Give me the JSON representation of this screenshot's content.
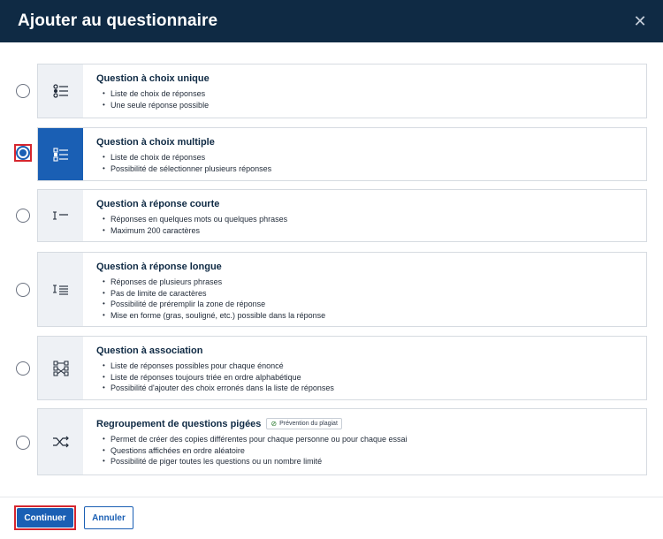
{
  "dialog": {
    "title": "Ajouter au questionnaire",
    "close_icon": "close-icon"
  },
  "options": [
    {
      "id": "choix-unique",
      "title": "Question à choix unique",
      "icon": "single-choice-list-icon",
      "selected": false,
      "bullets": [
        "Liste de choix de réponses",
        "Une seule réponse possible"
      ]
    },
    {
      "id": "choix-multiple",
      "title": "Question à choix multiple",
      "icon": "multiple-choice-list-icon",
      "selected": true,
      "bullets": [
        "Liste de choix de réponses",
        "Possibilité de sélectionner plusieurs réponses"
      ]
    },
    {
      "id": "reponse-courte",
      "title": "Question à réponse courte",
      "icon": "short-text-icon",
      "selected": false,
      "bullets": [
        "Réponses en quelques mots ou quelques phrases",
        "Maximum 200 caractères"
      ]
    },
    {
      "id": "reponse-longue",
      "title": "Question à réponse longue",
      "icon": "long-text-icon",
      "selected": false,
      "bullets": [
        "Réponses de plusieurs phrases",
        "Pas de limite de caractères",
        "Possibilité de préremplir la zone de réponse",
        "Mise en forme (gras, souligné, etc.) possible dans la réponse"
      ]
    },
    {
      "id": "association",
      "title": "Question à association",
      "icon": "association-icon",
      "selected": false,
      "bullets": [
        "Liste de réponses possibles pour chaque énoncé",
        "Liste de réponses toujours triée en ordre alphabétique",
        "Possibilité d'ajouter des choix erronés dans la liste de réponses"
      ]
    },
    {
      "id": "questions-pigees",
      "title": "Regroupement de questions pigées",
      "icon": "shuffle-icon",
      "selected": false,
      "badge": "Prévention du plagiat",
      "bullets": [
        "Permet de créer des copies différentes pour chaque personne ou pour chaque essai",
        "Questions affichées en ordre aléatoire",
        "Possibilité de piger toutes les questions ou un nombre limité"
      ]
    }
  ],
  "footer": {
    "continue_label": "Continuer",
    "cancel_label": "Annuler"
  },
  "colors": {
    "header_bg": "#0f2a44",
    "accent": "#1a5fb4",
    "focus_ring": "#d6262e"
  }
}
